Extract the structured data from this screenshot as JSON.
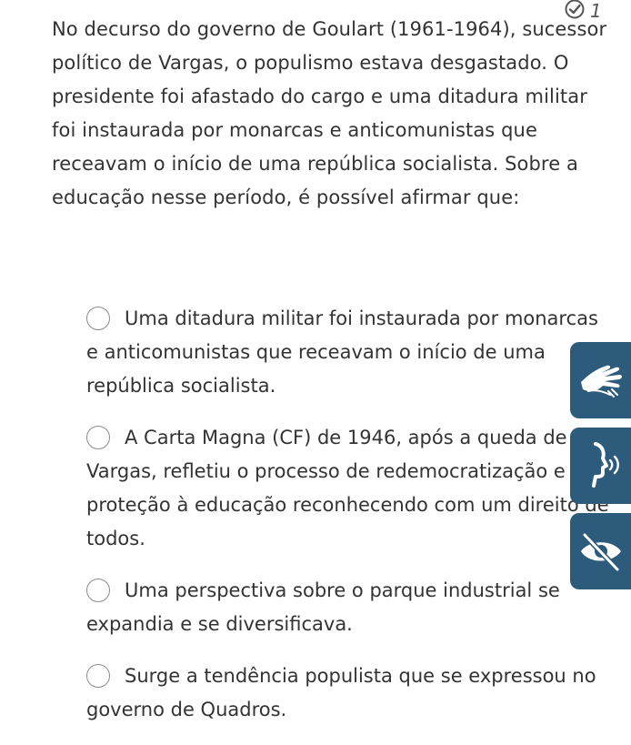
{
  "badge": {
    "count": "1",
    "icon": "check-circle-icon"
  },
  "question": {
    "text": "No decurso do governo de Goulart (1961-1964), sucessor político de Vargas, o populismo estava desgastado. O presidente foi afastado do cargo e uma ditadura militar foi instaurada por monarcas e anticomunistas que receavam o início de uma república socialista. Sobre a educação nesse período, é possível afirmar que:"
  },
  "options": [
    {
      "label": "Uma ditadura militar foi instaurada por monarcas e anticomunistas que receavam o início de uma república socialista."
    },
    {
      "label": "A Carta Magna (CF) de 1946, após a queda de Vargas, refletiu o processo de redemocratização e proteção à educação reconhecendo com um direito de todos."
    },
    {
      "label": "Uma perspectiva sobre o parque industrial se expandia e se diversificava."
    },
    {
      "label": "Surge a tendência populista que se expressou no governo de Quadros."
    }
  ],
  "accessibility": {
    "accent": "#2d5b7c",
    "buttons": [
      {
        "icon": "sign-language-icon"
      },
      {
        "icon": "audio-speech-icon"
      },
      {
        "icon": "eye-slash-icon"
      }
    ]
  }
}
